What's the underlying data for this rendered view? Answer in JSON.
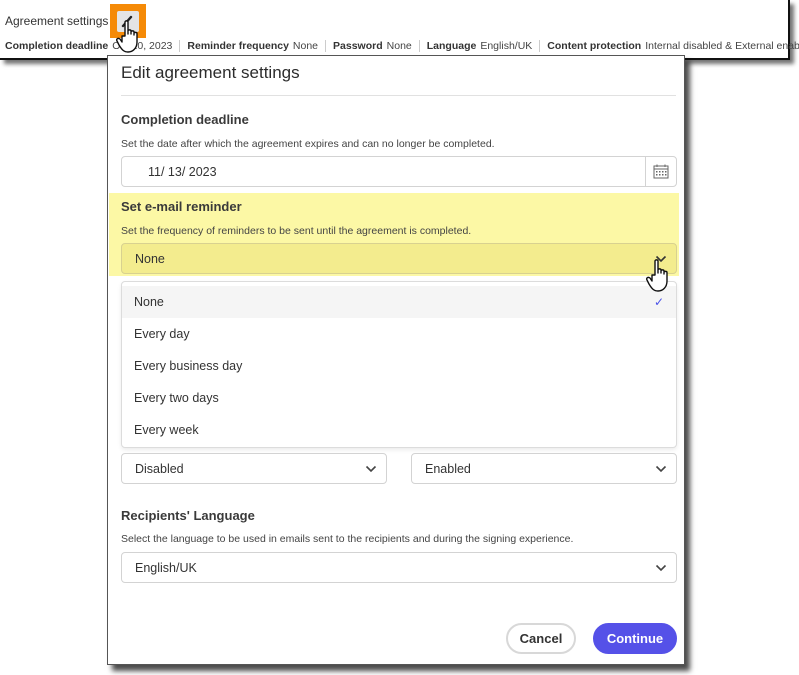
{
  "summary": {
    "title": "Agreement settings",
    "edit_icon": "pencil-icon",
    "items": [
      {
        "label": "Completion deadline",
        "value": "Oct 20, 2023"
      },
      {
        "label": "Reminder frequency",
        "value": "None"
      },
      {
        "label": "Password",
        "value": "None"
      },
      {
        "label": "Language",
        "value": "English/UK"
      },
      {
        "label": "Content protection",
        "value": "Internal disabled & External enabled"
      }
    ]
  },
  "dialog": {
    "title": "Edit agreement settings",
    "completion_deadline": {
      "title": "Completion deadline",
      "description": "Set the date after which the agreement expires and can no longer be completed.",
      "value": "11/ 13/ 2023",
      "icon": "calendar-icon"
    },
    "email_reminder": {
      "title": "Set e-mail reminder",
      "description": "Set the frequency of reminders to be sent until the agreement is completed.",
      "value": "None",
      "highlight_color": "#fcf8a5",
      "options": [
        {
          "label": "None",
          "selected": true
        },
        {
          "label": "Every day",
          "selected": false
        },
        {
          "label": "Every business day",
          "selected": false
        },
        {
          "label": "Every two days",
          "selected": false
        },
        {
          "label": "Every week",
          "selected": false
        }
      ],
      "check_glyph": "✓"
    },
    "content_protection": {
      "internal_value": "Disabled",
      "external_value": "Enabled"
    },
    "language": {
      "title": "Recipients' Language",
      "description": "Select the language to be used in emails sent to the recipients and during the signing experience.",
      "value": "English/UK"
    },
    "buttons": {
      "cancel": "Cancel",
      "continue": "Continue"
    }
  },
  "colors": {
    "accent": "#5551e8",
    "edit_highlight": "#f58a07"
  }
}
